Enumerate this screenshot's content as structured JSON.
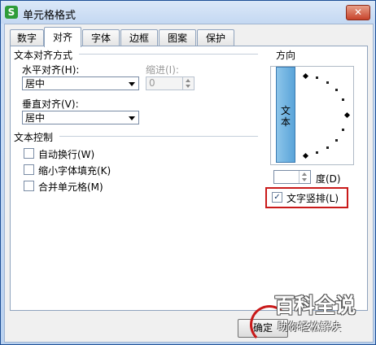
{
  "window": {
    "title": "单元格格式",
    "app_icon_letter": "S",
    "close_glyph": "✕"
  },
  "tabs": [
    {
      "label": "数字"
    },
    {
      "label": "对齐"
    },
    {
      "label": "字体"
    },
    {
      "label": "边框"
    },
    {
      "label": "图案"
    },
    {
      "label": "保护"
    }
  ],
  "active_tab": "对齐",
  "text_alignment": {
    "group_label": "文本对齐方式",
    "horizontal_label": "水平对齐(H):",
    "horizontal_value": "居中",
    "indent_label": "缩进(I):",
    "indent_value": "0",
    "vertical_label": "垂直对齐(V):",
    "vertical_value": "居中"
  },
  "text_control": {
    "group_label": "文本控制",
    "options": [
      {
        "label": "自动换行(W)",
        "checked": false
      },
      {
        "label": "缩小字体填充(K)",
        "checked": false
      },
      {
        "label": "合并单元格(M)",
        "checked": false
      }
    ]
  },
  "orientation": {
    "group_label": "方向",
    "vertical_text_button": "文本",
    "degrees_value": "",
    "degrees_label": "度(D)",
    "vertical_text_checkbox": {
      "label": "文字竖排(L)",
      "checked": true,
      "check_glyph": "✓"
    }
  },
  "buttons": {
    "ok": "确定"
  },
  "watermark": {
    "title": "百科全说",
    "subtitle": "助你轻松解决"
  },
  "colors": {
    "highlight": "#c91a1a",
    "titlebar": "#c4d8f2"
  }
}
